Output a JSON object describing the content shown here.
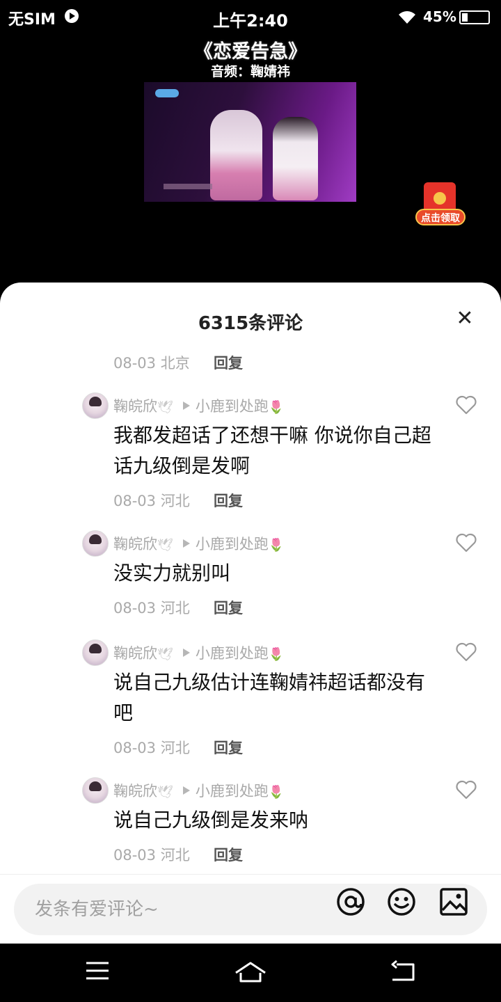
{
  "status_bar": {
    "carrier": "无SIM",
    "time": "上午2:40",
    "battery": "45%"
  },
  "video": {
    "title": "《恋爱告急》",
    "subtitle": "音频：鞠婧祎"
  },
  "red_packet": {
    "label": "点击领取"
  },
  "comments_panel": {
    "title": "6315条评论",
    "top_meta": {
      "datetime": "08-03 北京",
      "reply": "回复"
    },
    "comments": [
      {
        "author": "鞠皖欣",
        "reply_to": "小鹿到处跑",
        "text": "我都发超话了还想干嘛 你说你自己超话九级倒是发啊",
        "datetime": "08-03 河北",
        "reply": "回复"
      },
      {
        "author": "鞠皖欣",
        "reply_to": "小鹿到处跑",
        "text": "没实力就别叫",
        "datetime": "08-03 河北",
        "reply": "回复"
      },
      {
        "author": "鞠皖欣",
        "reply_to": "小鹿到处跑",
        "text": "说自己九级估计连鞠婧祎超话都没有吧",
        "datetime": "08-03 河北",
        "reply": "回复"
      },
      {
        "author": "鞠皖欣",
        "reply_to": "小鹿到处跑",
        "text": "说自己九级倒是发来呐",
        "datetime": "08-03 河北",
        "reply": "回复"
      }
    ]
  },
  "input": {
    "placeholder": "发条有爱评论~"
  },
  "icons": {
    "at": "at-icon",
    "emoji": "emoji-icon",
    "image": "image-icon",
    "close": "close-icon",
    "heart": "heart-icon",
    "menu": "menu-icon",
    "home": "home-icon",
    "back": "back-icon"
  }
}
